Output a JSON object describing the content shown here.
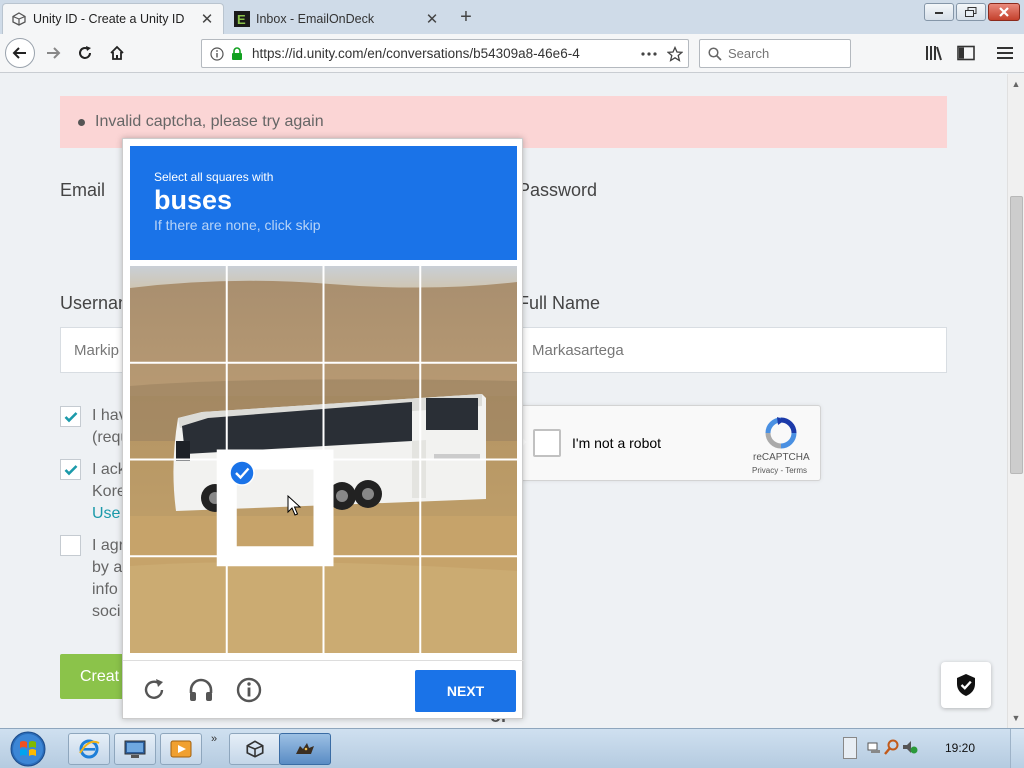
{
  "browser": {
    "tabs": [
      {
        "title": "Unity ID - Create a Unity ID",
        "favicon": "unity-icon",
        "active": true
      },
      {
        "title": "Inbox - EmailOnDeck",
        "favicon": "emailondeck-icon",
        "active": false
      }
    ],
    "url": "https://id.unity.com/en/conversations/b54309a8-46e6-4",
    "search_placeholder": "Search"
  },
  "page": {
    "alert_text": "Invalid captcha, please try again",
    "email_label": "Email",
    "password_label": "Password",
    "username_label": "Usernam",
    "username_value": "Markip",
    "fullname_label": "Full Name",
    "fullname_value": "Markasartega",
    "checkbox_rows": [
      {
        "checked": true,
        "lines": [
          "I hav",
          "(requ"
        ]
      },
      {
        "checked": true,
        "lines": [
          "I ack",
          "Kore",
          "Use"
        ]
      },
      {
        "checked": false,
        "lines": [
          "I agr",
          "by a",
          "info",
          "soci"
        ]
      }
    ],
    "create_label": "Creat",
    "or_text": "or"
  },
  "recaptcha_widget": {
    "label": "I'm not a robot",
    "brand": "reCAPTCHA",
    "privacy": "Privacy",
    "sep": " - ",
    "terms": "Terms"
  },
  "captcha": {
    "instruction": "Select all squares with",
    "target": "buses",
    "hint": "If there are none, click skip",
    "grid": {
      "rows": 4,
      "cols": 4,
      "selected": [
        [
          2,
          1
        ]
      ]
    },
    "next_label": "NEXT",
    "footer_icons": [
      "reload-icon",
      "audio-icon",
      "info-icon"
    ]
  },
  "taskbar": {
    "clock": "19:20",
    "apps": [
      "ie-icon",
      "computer-icon",
      "media-player-icon",
      "unity-app-icon",
      "wolf-app-icon"
    ]
  },
  "colors": {
    "captcha_blue": "#1a73e8",
    "alert_bg": "#fbd5d5",
    "create_green": "#8bc34a",
    "link_teal": "#1b9aaa"
  }
}
